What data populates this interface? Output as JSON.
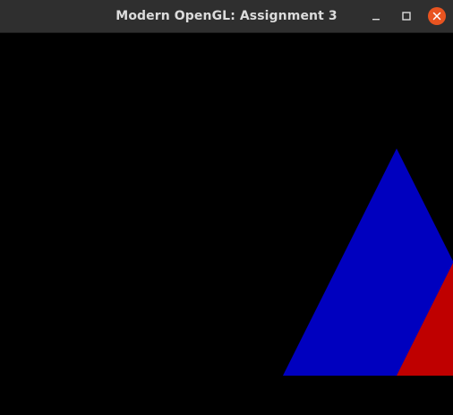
{
  "window": {
    "title": "Modern OpenGL: Assignment 3"
  },
  "controls": {
    "minimize_icon": "minimize-icon",
    "maximize_icon": "maximize-icon",
    "close_icon": "close-icon"
  },
  "scene": {
    "background_color": "#000000",
    "triangles": [
      {
        "color": "#0000bf"
      },
      {
        "color": "#bf0000"
      }
    ]
  },
  "colors": {
    "titlebar": "#2f2f2f",
    "title_text": "#dcdcdc",
    "close_button": "#e95420"
  }
}
